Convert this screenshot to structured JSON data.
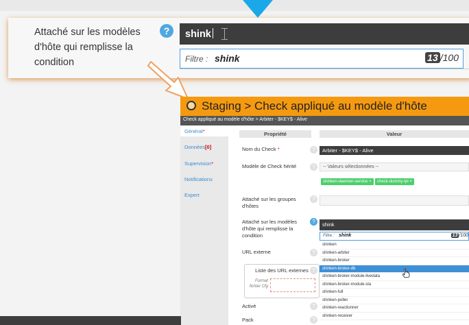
{
  "colors": {
    "accent_blue": "#1aa8e8",
    "header_orange": "#f59a10",
    "input_dark": "#3d3d3d",
    "chip_green": "#4dcf6b",
    "selected_blue": "#3d8fd6"
  },
  "zoom": {
    "label": "Attaché sur les modèles d'hôte qui remplisse la condition",
    "help_glyph": "?",
    "input_value": "shink",
    "filter_label": "Filtre :",
    "filter_value": "shink",
    "count": "13",
    "total": "/100"
  },
  "page": {
    "title": "Staging > Check appliqué au modèle d'hôte",
    "breadcrumb": "Check appliqué au modèle d'hôte > Arbiter - $KEY$ - Alive",
    "sidebar": [
      {
        "label": "Général",
        "req": "*"
      },
      {
        "label": "Données",
        "badge": "[0]"
      },
      {
        "label": "Supervision",
        "req": "*"
      },
      {
        "label": "Notifications",
        "req": ""
      },
      {
        "label": "Expert",
        "req": ""
      }
    ],
    "columns": {
      "property": "Propriété",
      "value": "Valeur"
    },
    "rows": {
      "check_name": {
        "label": "Nom du Check",
        "req": "*",
        "value": "Arbiter - $KEY$ - Alive"
      },
      "check_model": {
        "label": "Modèle de Check hérité",
        "select_placeholder": "-- Valeurs sélectionnées --",
        "chips": [
          "shinken-daemon-service ×",
          "check-dummy-tpl ×"
        ]
      },
      "host_groups": {
        "label": "Attaché sur les groupes d'hôtes"
      },
      "host_models": {
        "label": "Attaché sur les modèles d'hôte qui remplisse la condition",
        "value": "shink"
      },
      "url_external": {
        "label": "URL externe"
      },
      "url_list": {
        "label": "Liste des URL externes",
        "format_label": "Format fichier Cfg"
      },
      "enabled": {
        "label": "Activé"
      },
      "pack": {
        "label": "Pack"
      }
    },
    "filter": {
      "label": "Filtre :",
      "value": "shink",
      "count": "13",
      "total": "/100"
    },
    "options": [
      "shinken",
      "shinken-arbiter",
      "shinken-broker",
      "shinken-broker-db",
      "shinken-broker-module-livedata",
      "shinken-broker-module-sla",
      "shinken-full",
      "shinken-poller",
      "shinken-reactionner",
      "shinken-receiver"
    ],
    "selected_option_index": 3
  }
}
